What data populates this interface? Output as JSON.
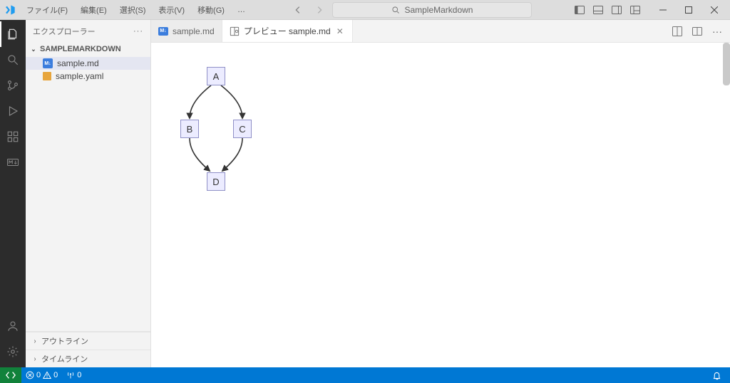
{
  "titlebar": {
    "menus": [
      "ファイル(F)",
      "編集(E)",
      "選択(S)",
      "表示(V)",
      "移動(G)"
    ],
    "overflow": "…",
    "search_placeholder": "SampleMarkdown"
  },
  "window_controls": {
    "minimize": "—",
    "maximize": "▢",
    "close": "✕"
  },
  "sidebar": {
    "title": "エクスプローラー",
    "folder": "SAMPLEMARKDOWN",
    "files": [
      {
        "name": "sample.md",
        "icon": "md",
        "selected": true
      },
      {
        "name": "sample.yaml",
        "icon": "yaml",
        "selected": false
      }
    ],
    "outline": "アウトライン",
    "timeline": "タイムライン"
  },
  "tabs": [
    {
      "label": "sample.md",
      "icon": "md",
      "active": false,
      "closable": false
    },
    {
      "label": "プレビュー sample.md",
      "icon": "preview",
      "active": true,
      "closable": true
    }
  ],
  "chart_data": {
    "type": "flowchart",
    "nodes": [
      "A",
      "B",
      "C",
      "D"
    ],
    "edges": [
      [
        "A",
        "B"
      ],
      [
        "A",
        "C"
      ],
      [
        "B",
        "D"
      ],
      [
        "C",
        "D"
      ]
    ]
  },
  "statusbar": {
    "errors": "0",
    "warnings": "0",
    "ports": "0"
  }
}
